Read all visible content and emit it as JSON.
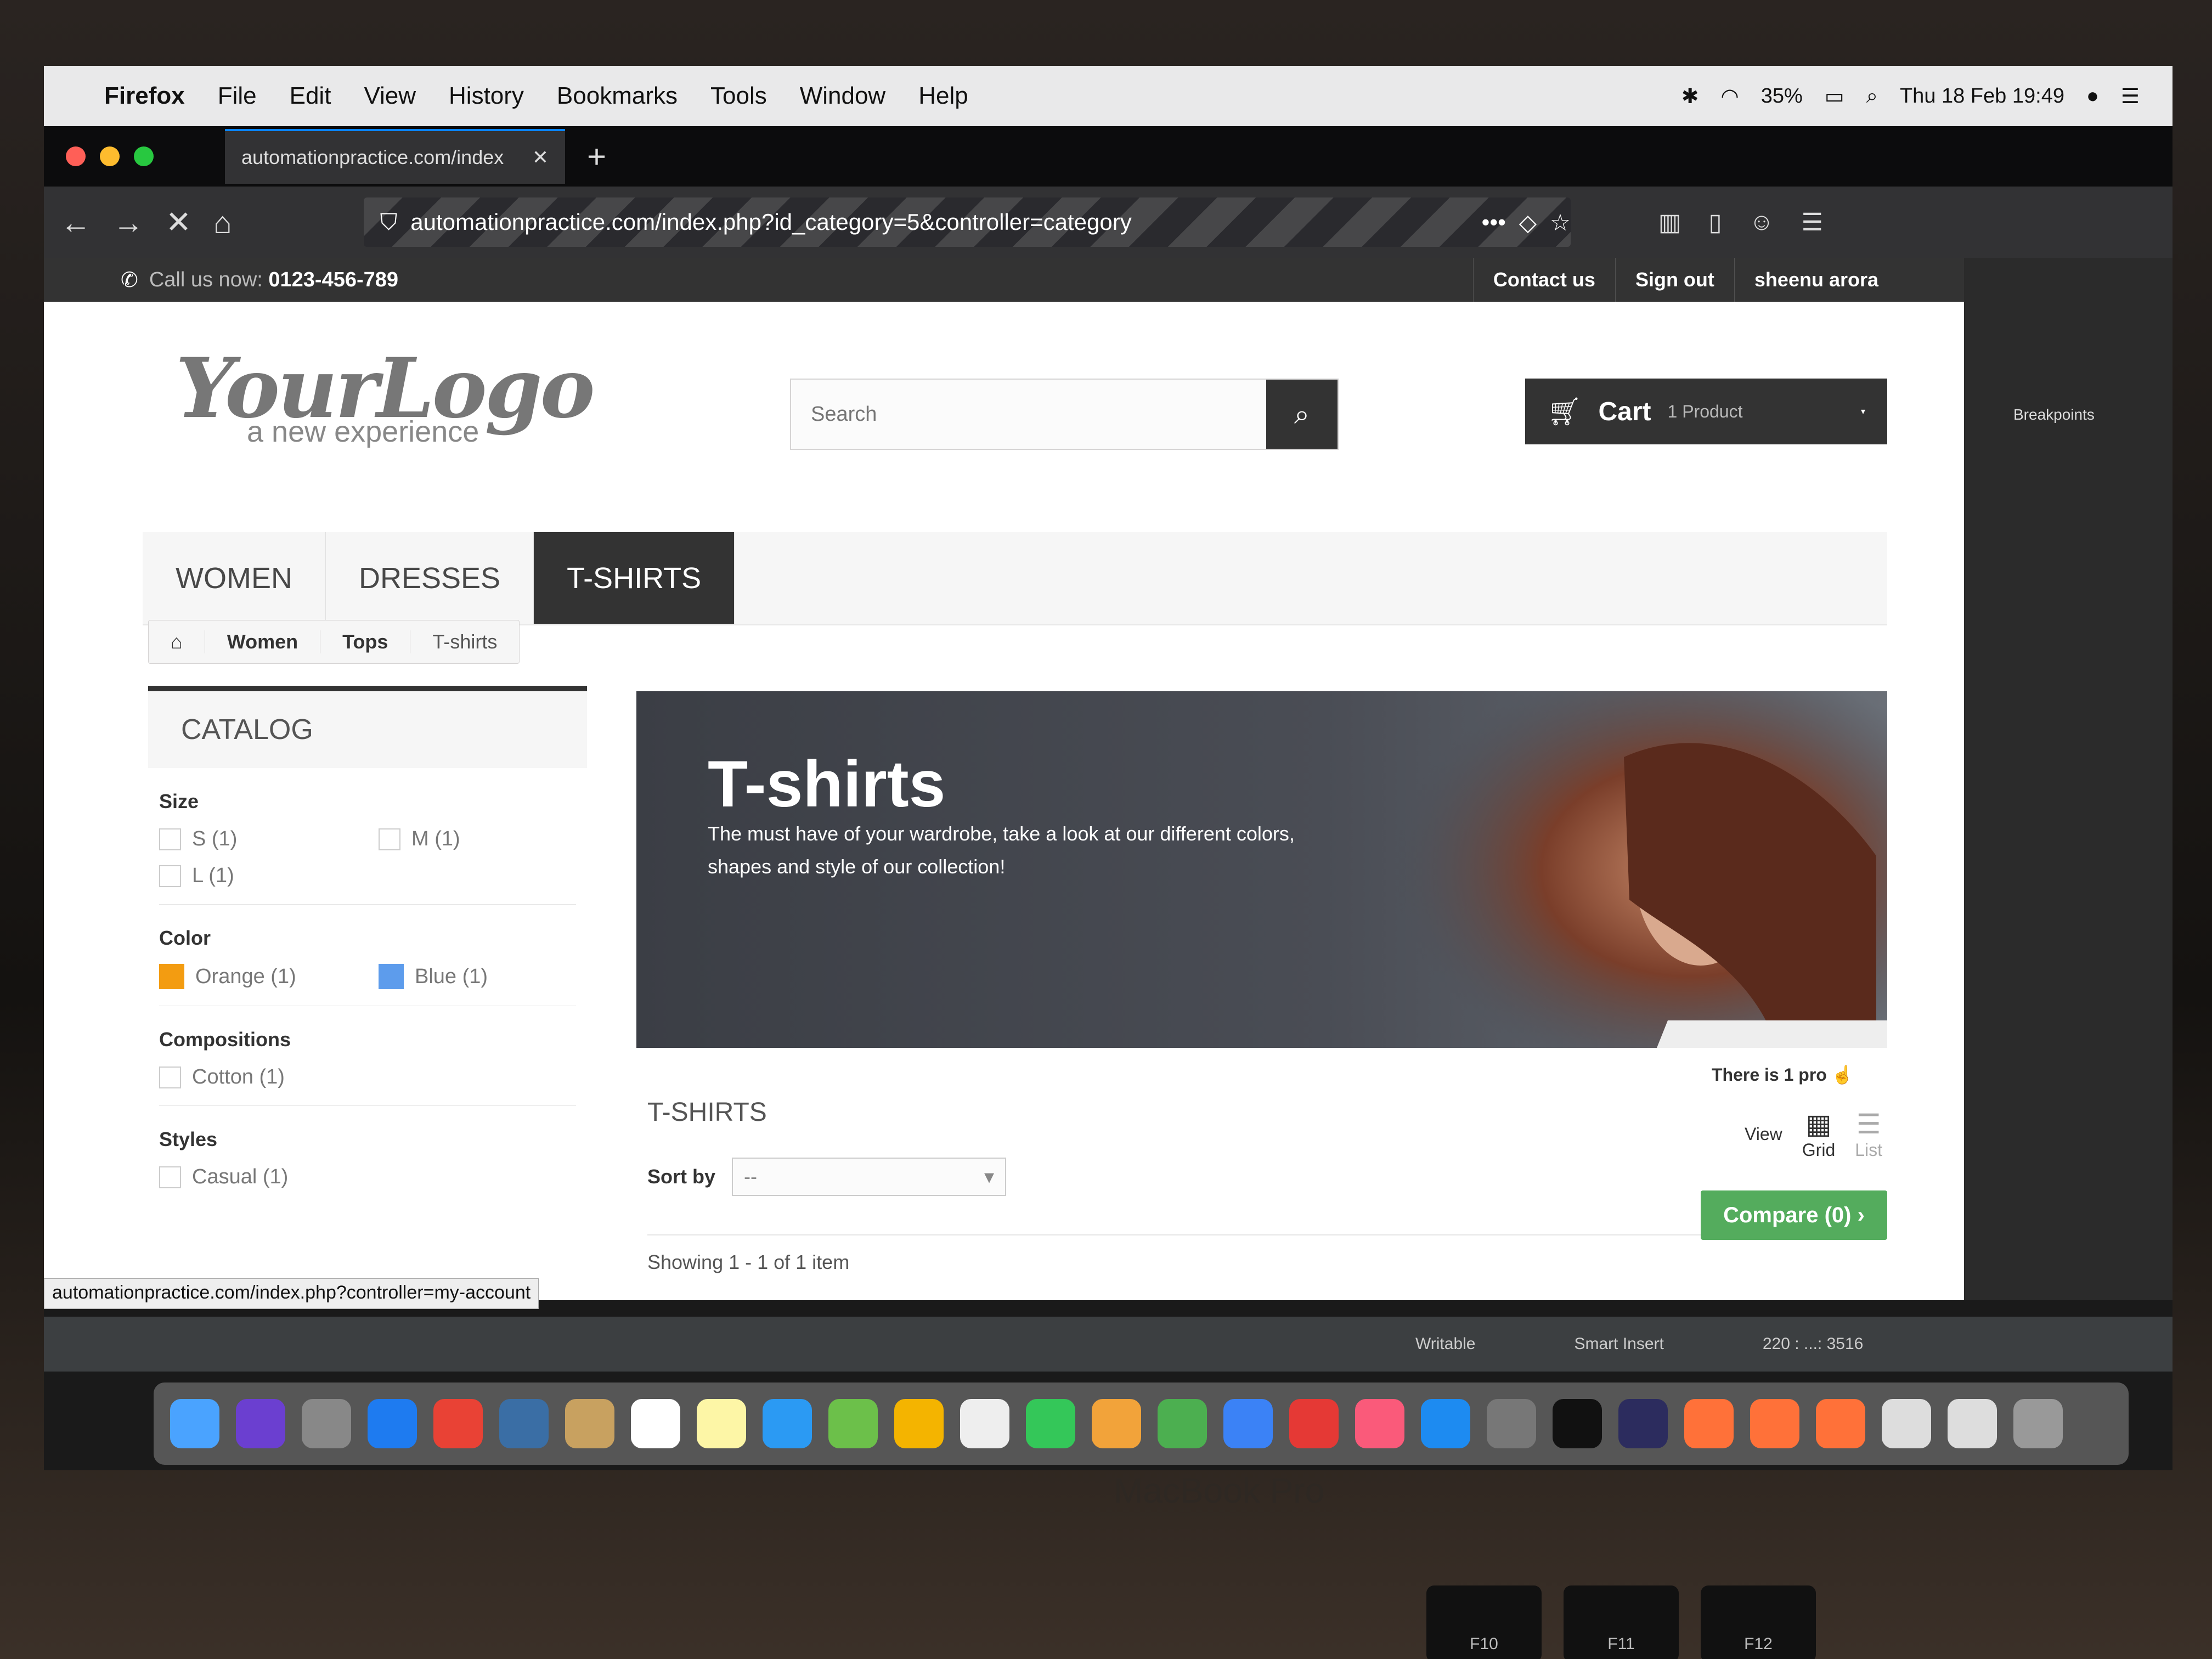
{
  "menubar": {
    "app": "Firefox",
    "items": [
      "File",
      "Edit",
      "View",
      "History",
      "Bookmarks",
      "Tools",
      "Window",
      "Help"
    ],
    "battery": "35%",
    "datetime": "Thu 18 Feb  19:49"
  },
  "browser": {
    "tab_title": "automationpractice.com/index",
    "url": "automationpractice.com/index.php?id_category=5&controller=category",
    "status_url": "automationpractice.com/index.php?controller=my-account"
  },
  "site": {
    "call_label": "Call us now:",
    "phone": "0123-456-789",
    "top_links": [
      "Contact us",
      "Sign out",
      "sheenu arora"
    ],
    "logo_main": "YourLogo",
    "logo_sub": "a new experience",
    "search_placeholder": "Search",
    "cart_label": "Cart",
    "cart_qty": "1 Product",
    "menu": [
      "WOMEN",
      "DRESSES",
      "T-SHIRTS"
    ],
    "breadcrumb": [
      "Women",
      "Tops",
      "T-shirts"
    ]
  },
  "catalog": {
    "title": "CATALOG",
    "size_label": "Size",
    "sizes": [
      "S (1)",
      "M (1)",
      "L (1)"
    ],
    "color_label": "Color",
    "colors": [
      {
        "label": "Orange (1)",
        "hex": "#f39c11"
      },
      {
        "label": "Blue (1)",
        "hex": "#5D9CEC"
      }
    ],
    "comp_label": "Compositions",
    "compositions": [
      "Cotton (1)"
    ],
    "styles_label": "Styles",
    "styles": [
      "Casual (1)"
    ]
  },
  "content": {
    "banner_title": "T-shirts",
    "banner_text": "The must have of your wardrobe, take a look at our different colors, shapes and style of our collection!",
    "count_text": "There is 1 pro",
    "product_title": "T-SHIRTS",
    "view_label": "View",
    "grid_label": "Grid",
    "list_label": "List",
    "sort_label": "Sort by",
    "sort_value": "--",
    "compare_label": "Compare (0)",
    "showing": "Showing 1 - 1 of 1 item"
  },
  "ide": {
    "breakpoints": "Breakpoints",
    "writable": "Writable",
    "insert": "Smart Insert",
    "position": "220 : ...: 3516"
  },
  "device": {
    "brand": "MacBook Pro",
    "keys": [
      "F10",
      "F11",
      "F12"
    ]
  }
}
